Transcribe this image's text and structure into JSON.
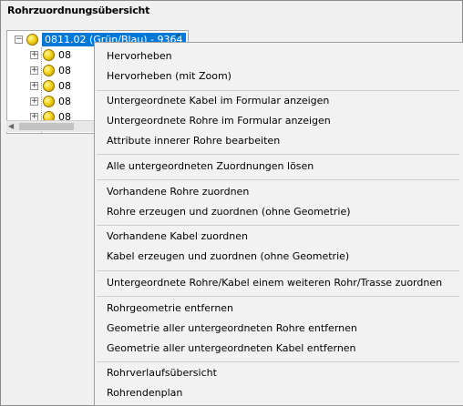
{
  "panel": {
    "title": "Rohrzuordnungsübersicht"
  },
  "tree": {
    "root_label": "0811.02 (Grün/Blau) - 9364",
    "children": [
      {
        "label": "08"
      },
      {
        "label": "08"
      },
      {
        "label": "08"
      },
      {
        "label": "08"
      },
      {
        "label": "08"
      }
    ],
    "collapse_glyph": "−",
    "expand_glyph": "+",
    "scroll_up_glyph": "⌃",
    "hscroll_left_glyph": "◀"
  },
  "context_menu": {
    "groups": [
      [
        "Hervorheben",
        "Hervorheben (mit Zoom)"
      ],
      [
        "Untergeordnete Kabel im Formular anzeigen",
        "Untergeordnete Rohre im Formular anzeigen",
        "Attribute innerer Rohre bearbeiten"
      ],
      [
        "Alle untergeordneten Zuordnungen lösen"
      ],
      [
        "Vorhandene Rohre zuordnen",
        "Rohre erzeugen und zuordnen (ohne Geometrie)"
      ],
      [
        "Vorhandene Kabel zuordnen",
        "Kabel erzeugen und zuordnen (ohne Geometrie)"
      ],
      [
        "Untergeordnete Rohre/Kabel einem weiteren Rohr/Trasse zuordnen"
      ],
      [
        "Rohrgeometrie entfernen",
        "Geometrie aller untergeordneten Rohre entfernen",
        "Geometrie aller untergeordneten Kabel entfernen"
      ],
      [
        "Rohrverlaufsübersicht",
        "Rohrendenplan"
      ]
    ]
  }
}
